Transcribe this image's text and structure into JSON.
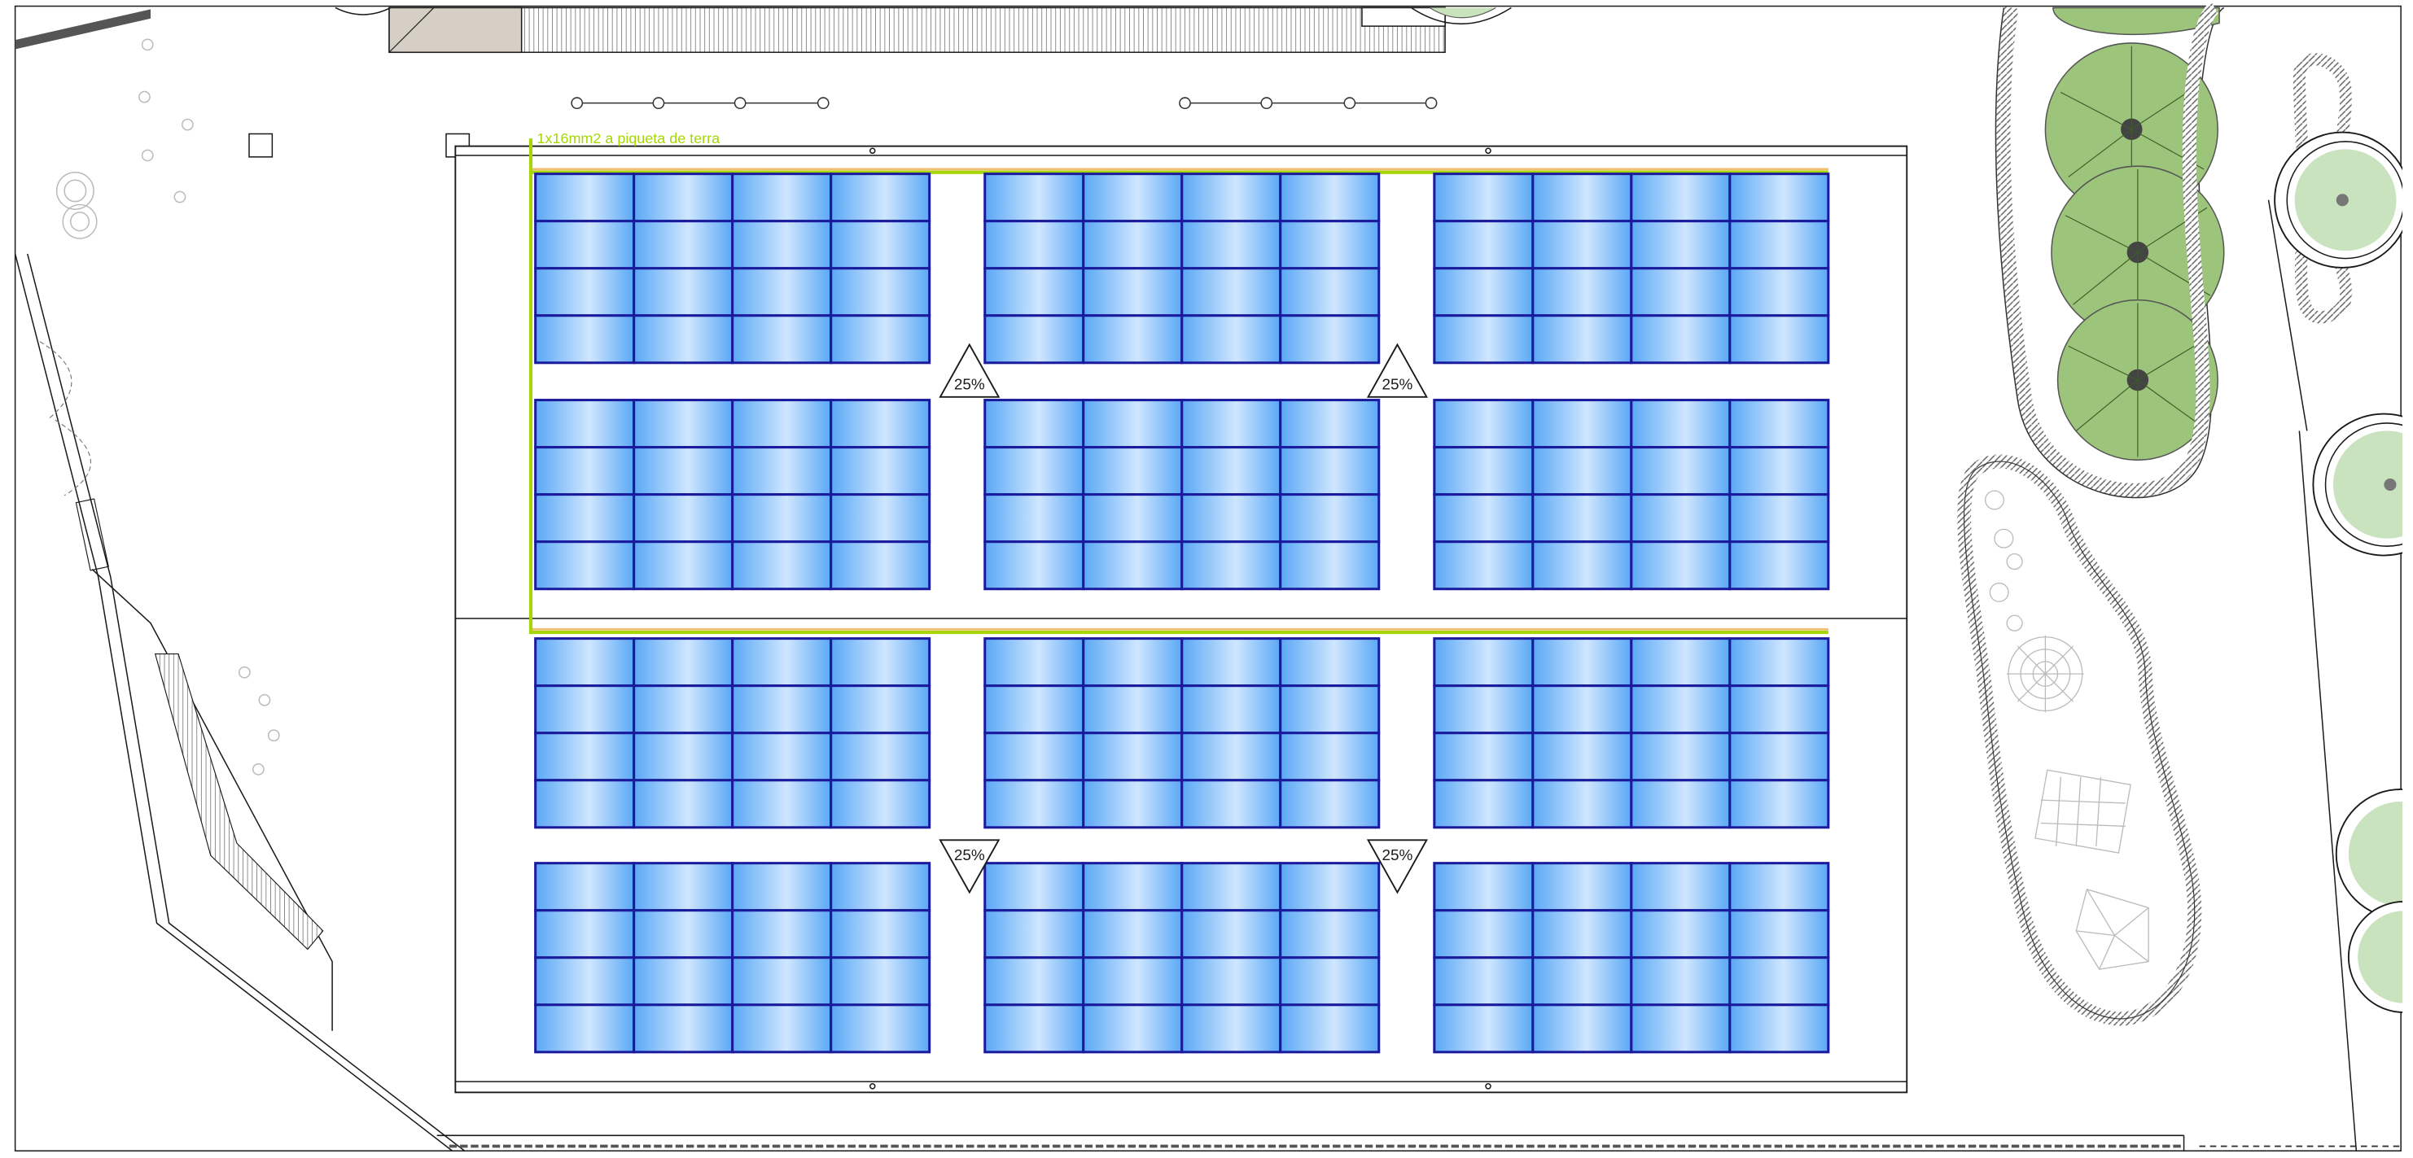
{
  "drawing": {
    "ground_label": "1x16mm2 a piqueta de terra",
    "slopes": [
      {
        "label": "25%",
        "direction": "up"
      },
      {
        "label": "25%",
        "direction": "up"
      },
      {
        "label": "25%",
        "direction": "down"
      },
      {
        "label": "25%",
        "direction": "down"
      }
    ],
    "array_grid": {
      "block_rows": 4,
      "block_cols": 3,
      "module_rows_per_block": 4,
      "module_cols_per_block": 4
    },
    "colors": {
      "module_frame": "#1a1a9c",
      "module_fill_dark": "#5aa8f5",
      "module_fill_light": "#eaf4ff",
      "ground_wire": "#a6d608",
      "cable_tray": "#f0c070",
      "tree_fill": "#9cc47a",
      "tree_fill_light": "#c8e3bd",
      "line": "#1a1a1a"
    }
  }
}
